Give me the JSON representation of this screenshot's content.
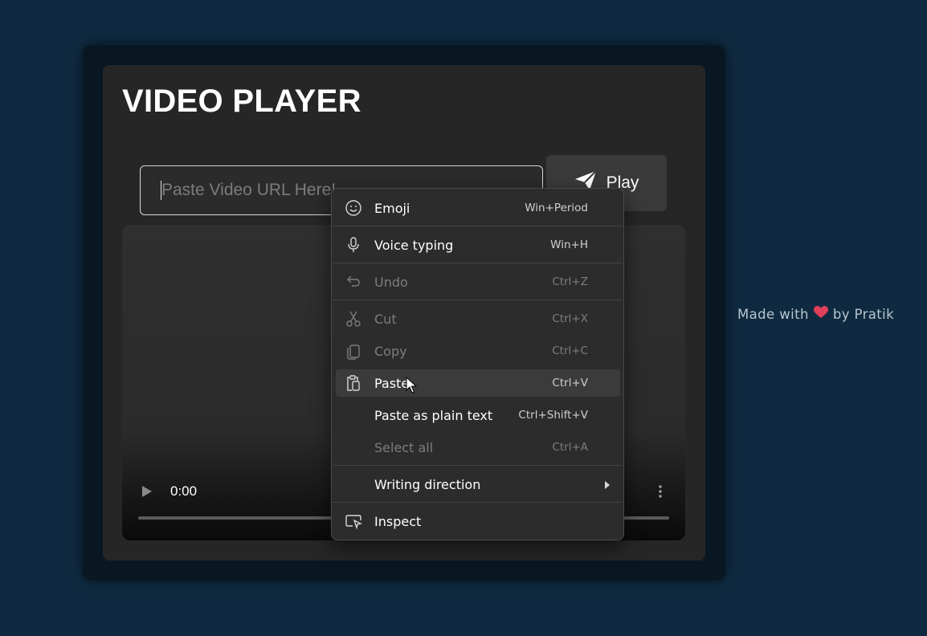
{
  "app": {
    "title": "VIDEO PLAYER"
  },
  "url_input": {
    "placeholder": "Paste Video URL Here!",
    "value": ""
  },
  "play_button": {
    "label": "Play"
  },
  "video": {
    "time": "0:00",
    "progress": 0
  },
  "credit": {
    "prefix": "Made with",
    "suffix": "by Pratik"
  },
  "colors": {
    "background": "#0f2a40",
    "card": "#262626",
    "heart": "#e0405a"
  },
  "context_menu": {
    "items": [
      {
        "label": "Emoji",
        "shortcut": "Win+Period",
        "icon": "emoji-icon",
        "enabled": true
      },
      {
        "label": "Voice typing",
        "shortcut": "Win+H",
        "icon": "microphone-icon",
        "enabled": true
      },
      {
        "label": "Undo",
        "shortcut": "Ctrl+Z",
        "icon": "undo-icon",
        "enabled": false
      },
      {
        "label": "Cut",
        "shortcut": "Ctrl+X",
        "icon": "scissors-icon",
        "enabled": false
      },
      {
        "label": "Copy",
        "shortcut": "Ctrl+C",
        "icon": "copy-icon",
        "enabled": false
      },
      {
        "label": "Paste",
        "shortcut": "Ctrl+V",
        "icon": "clipboard-icon",
        "enabled": true,
        "highlighted": true
      },
      {
        "label": "Paste as plain text",
        "shortcut": "Ctrl+Shift+V",
        "icon": "",
        "enabled": true
      },
      {
        "label": "Select all",
        "shortcut": "Ctrl+A",
        "icon": "",
        "enabled": false
      },
      {
        "label": "Writing direction",
        "shortcut": "",
        "icon": "",
        "enabled": true,
        "submenu": true
      },
      {
        "label": "Inspect",
        "shortcut": "",
        "icon": "inspect-icon",
        "enabled": true
      }
    ]
  }
}
